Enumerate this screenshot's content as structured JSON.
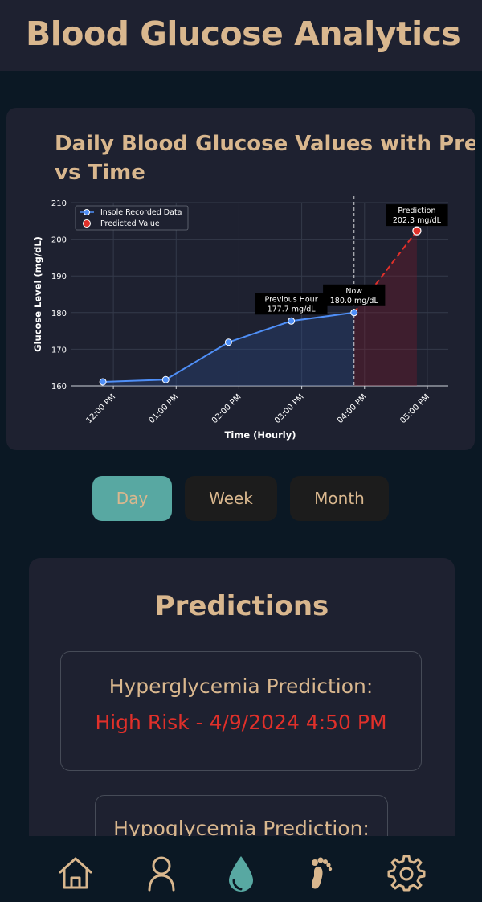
{
  "header": {
    "title": "Blood Glucose Analytics"
  },
  "chart_data": {
    "type": "line",
    "title": "Daily Blood Glucose Values with Prediction vs Time",
    "xlabel": "Time (Hourly)",
    "ylabel": "Glucose Level (mg/dL)",
    "ylim": [
      160,
      210
    ],
    "yticks": [
      160,
      170,
      180,
      190,
      200,
      210
    ],
    "xticks": [
      "12:00 PM",
      "01:00 PM",
      "02:00 PM",
      "03:00 PM",
      "04:00 PM",
      "05:00 PM"
    ],
    "grid": true,
    "legend_position": "top-left",
    "series": [
      {
        "name": "Insole Recorded Data",
        "color": "#4f8ff7",
        "x": [
          "11:50 AM",
          "12:50 PM",
          "01:50 PM",
          "02:50 PM",
          "03:50 PM"
        ],
        "y": [
          161.1,
          161.7,
          171.9,
          177.7,
          180.0
        ]
      },
      {
        "name": "Predicted Value",
        "color": "#e0302a",
        "x": [
          "03:50 PM",
          "04:50 PM"
        ],
        "y": [
          180.0,
          202.3
        ]
      }
    ],
    "now_marker": "03:50 PM",
    "annotations": [
      {
        "title": "Previous Hour",
        "text": "177.7 mg/dL"
      },
      {
        "title": "Now",
        "text": "180.0 mg/dL"
      },
      {
        "title": "Prediction",
        "text": "202.3 mg/dL"
      }
    ]
  },
  "range_tabs": [
    {
      "label": "Day",
      "active": true
    },
    {
      "label": "Week",
      "active": false
    },
    {
      "label": "Month",
      "active": false
    }
  ],
  "predictions": {
    "title": "Predictions",
    "hyper": {
      "label": "Hyperglycemia Prediction:",
      "value": "High Risk - 4/9/2024 4:50 PM"
    },
    "hypo": {
      "label": "Hypoglycemia Prediction:"
    }
  },
  "nav": {
    "items": [
      {
        "icon": "home-icon"
      },
      {
        "icon": "profile-icon"
      },
      {
        "icon": "glucose-drop-icon",
        "active": true
      },
      {
        "icon": "footprint-icon"
      },
      {
        "icon": "settings-gear-icon"
      }
    ]
  }
}
